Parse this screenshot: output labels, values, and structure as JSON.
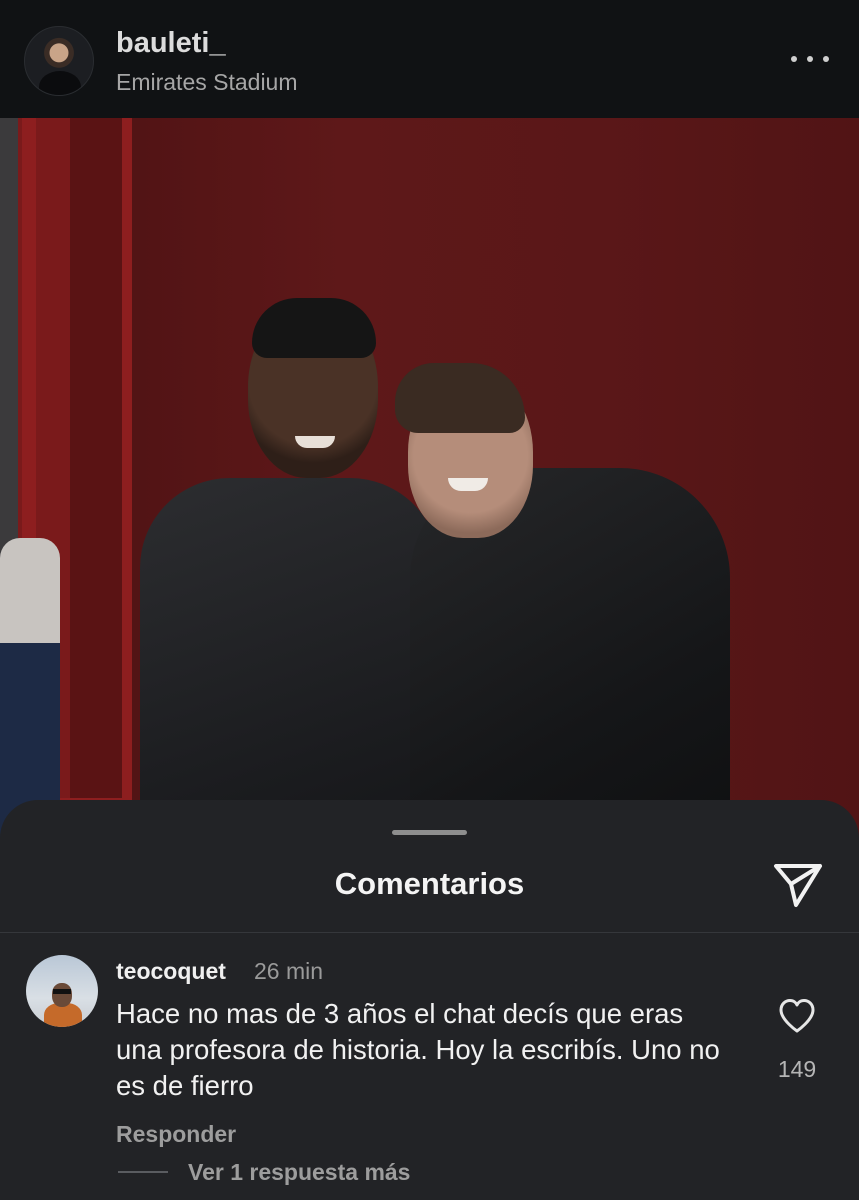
{
  "post": {
    "username": "bauleti_",
    "location": "Emirates Stadium"
  },
  "icons": {
    "more": "more-horizontal-icon",
    "send": "send-icon",
    "like": "heart-outline-icon"
  },
  "comments_sheet": {
    "title": "Comentarios",
    "comment": {
      "username": "teocoquet",
      "time": "26 min",
      "text": "Hace no mas de 3 años el chat decís que eras una profesora de historia. Hoy la escribís. Uno no es de fierro",
      "likes": "149",
      "reply_label": "Responder",
      "view_replies_label": "Ver 1 respuesta más"
    }
  },
  "colors": {
    "background": "#101214",
    "sheet": "#222326",
    "wall_red": "#5e1819"
  }
}
